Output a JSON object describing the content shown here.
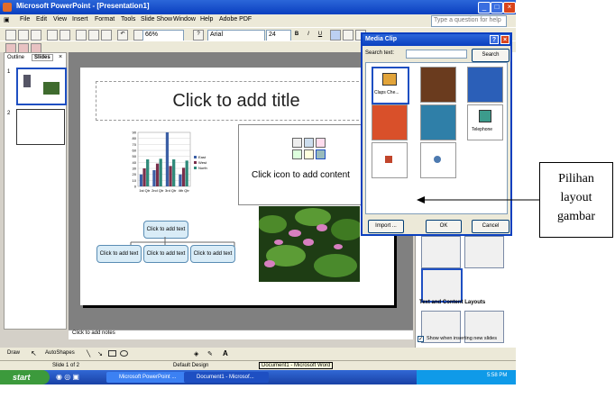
{
  "window": {
    "title": "Microsoft PowerPoint - [Presentation1]"
  },
  "menu": [
    "File",
    "Edit",
    "View",
    "Insert",
    "Format",
    "Tools",
    "Slide Show",
    "Window",
    "Help",
    "Adobe PDF"
  ],
  "help_box": {
    "placeholder": "Type a question for help"
  },
  "toolbar": {
    "zoom": "66%",
    "font": "Arial",
    "font_size": "24",
    "bold": "B",
    "italic": "I",
    "underline": "U"
  },
  "left_pane": {
    "tabs": [
      "Outline",
      "Slides"
    ],
    "slide_numbers": [
      "1",
      "2"
    ]
  },
  "slide": {
    "title_placeholder": "Click to add title",
    "content_placeholder": "Click icon to add content",
    "org_chart": {
      "top": "Click to add text",
      "children": [
        "Click to add text",
        "Click to add text",
        "Click to add text"
      ]
    }
  },
  "chart_data": {
    "type": "bar",
    "categories": [
      "1st Qtr",
      "2nd Qtr",
      "3rd Qtr",
      "4th Qtr"
    ],
    "series": [
      {
        "name": "East",
        "values": [
          20,
          27,
          90,
          20
        ]
      },
      {
        "name": "West",
        "values": [
          30,
          38,
          34,
          31
        ]
      },
      {
        "name": "North",
        "values": [
          45,
          46,
          45,
          43
        ]
      }
    ],
    "ylim": [
      0,
      90
    ],
    "yticks": [
      "90",
      "80",
      "70",
      "60",
      "50",
      "40",
      "30",
      "20",
      "10",
      "0"
    ],
    "colors": [
      "#3b5fa5",
      "#7a2f4b",
      "#2f8a7a"
    ]
  },
  "notes": "Click to add notes",
  "media_clip": {
    "title": "Media Clip",
    "search_label": "Search text:",
    "search_button": "Search",
    "clips": [
      "Claps Che...",
      "",
      "",
      "",
      "",
      "Telephone",
      "",
      ""
    ],
    "import_button": "Import ...",
    "ok_button": "OK",
    "cancel_button": "Cancel"
  },
  "task_pane": {
    "section": "Text and Content Layouts",
    "checkbox": "Show when inserting new slides"
  },
  "draw_toolbar": {
    "draw": "Draw",
    "autoshapes": "AutoShapes"
  },
  "status": {
    "slide": "Slide 1 of 2",
    "design": "Default Design",
    "tooltip": "Document1 - Microsoft Word"
  },
  "taskbar": {
    "start": "start",
    "tasks": [
      "Microsoft PowerPoint ...",
      "Document1 - Microsof..."
    ],
    "clock": "5:58 PM"
  },
  "annotation": {
    "lines": [
      "Pilihan",
      "layout",
      "gambar"
    ]
  }
}
